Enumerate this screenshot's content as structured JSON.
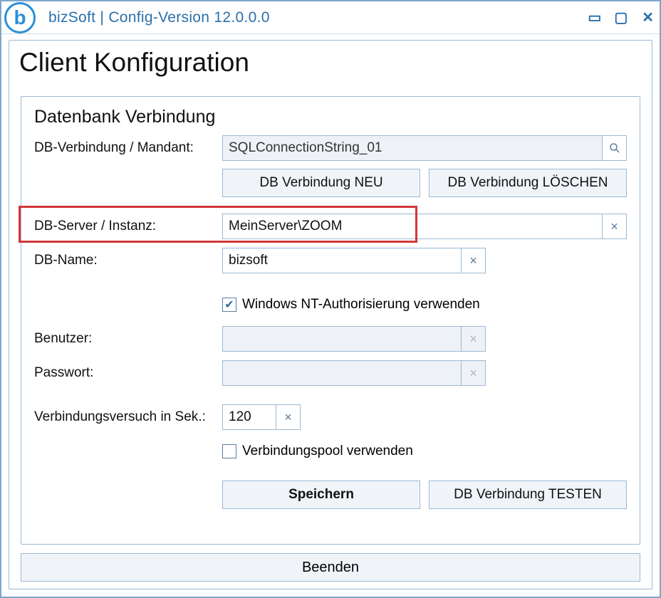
{
  "window": {
    "title": "bizSoft | Config-Version 12.0.0.0",
    "logo_letter": "b"
  },
  "page": {
    "heading": "Client Konfiguration"
  },
  "group": {
    "title": "Datenbank Verbindung",
    "labels": {
      "connection": "DB-Verbindung / Mandant:",
      "server": "DB-Server / Instanz:",
      "dbname": "DB-Name:",
      "user": "Benutzer:",
      "password": "Passwort:",
      "timeout": "Verbindungsversuch in Sek.:"
    },
    "values": {
      "connection": "SQLConnectionString_01",
      "server": "MeinServer\\ZOOM",
      "dbname": "bizsoft",
      "user": "",
      "password": "",
      "timeout": "120"
    },
    "buttons": {
      "new_conn": "DB Verbindung NEU",
      "del_conn": "DB Verbindung LÖSCHEN",
      "save": "Speichern",
      "test": "DB Verbindung TESTEN"
    },
    "checks": {
      "nt_auth_label": "Windows NT-Authorisierung verwenden",
      "nt_auth_checked": true,
      "pool_label": "Verbindungspool verwenden",
      "pool_checked": false
    }
  },
  "footer": {
    "close": "Beenden"
  },
  "icons": {
    "search": "🔍",
    "clear": "×",
    "check": "✔",
    "minimize": "▭",
    "maximize": "▢",
    "close": "✕"
  }
}
